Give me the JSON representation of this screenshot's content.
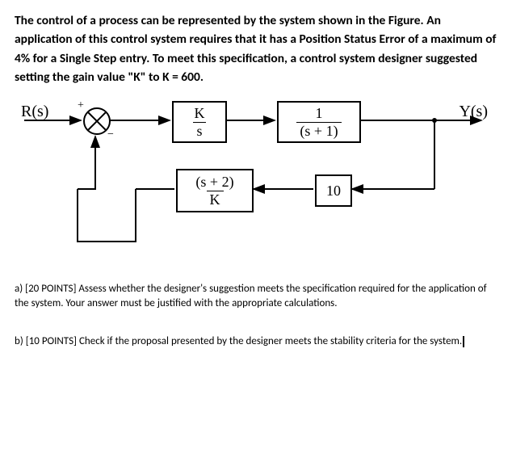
{
  "problem": {
    "statement": "The control of a process can be represented by the system shown in the Figure. An application of this control system requires that it has a Position Status Error of a maximum of 4% for a Single Step entry. To meet this specification, a control system designer suggested setting the gain value \"K\" to K = 600."
  },
  "diagram": {
    "input_label": "R(s)",
    "output_label": "Y(s)",
    "sum_plus": "+",
    "sum_minus": "−",
    "block1": {
      "num": "K",
      "den": "s"
    },
    "block2": {
      "num": "1",
      "den": "(s + 1)"
    },
    "block3": {
      "num": "(s + 2)",
      "den": "K"
    },
    "block4": "10"
  },
  "questions": {
    "a": "a) [20 POINTS] Assess whether the designer's suggestion meets the specification required for the application of the system. Your answer must be justified with the appropriate calculations.",
    "b": "b) [10 POINTS] Check if the proposal presented by the designer meets the stability criteria for the system."
  }
}
